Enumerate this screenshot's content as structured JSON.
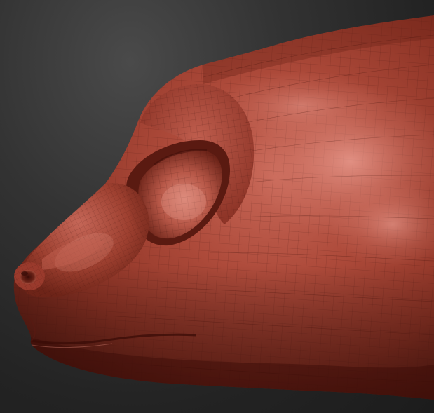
{
  "viewport": {
    "background_color": "#2e2e2e",
    "model_color": "#9a3a2c",
    "highlight_color": "#d9857a",
    "shadow_color": "#4a1610",
    "wireframe": true
  }
}
